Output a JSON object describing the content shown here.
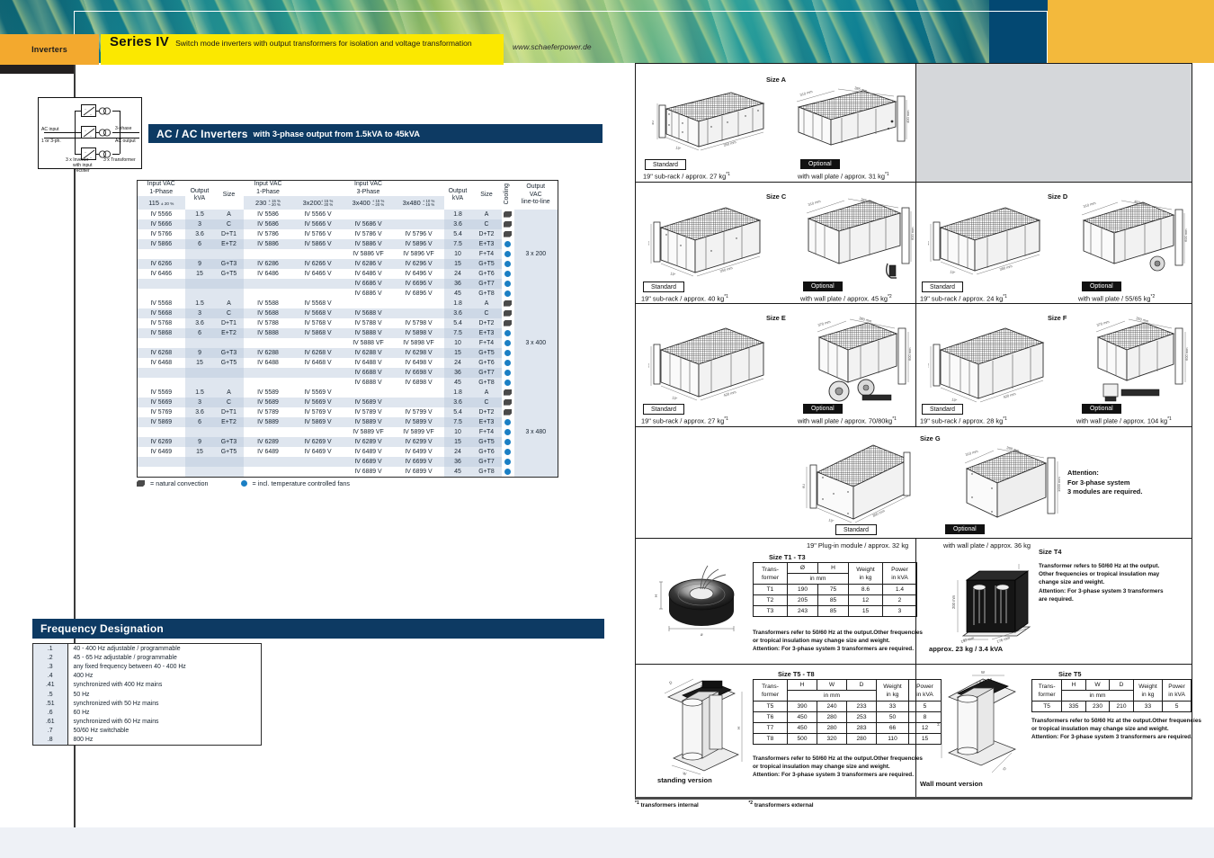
{
  "header": {
    "category": "Inverters",
    "series": "Series IV",
    "subtitle": "Switch mode inverters with output transformers for isolation and voltage transformation",
    "url": "www.schaeferpower.de",
    "accent_yellow": "#fbe800",
    "accent_orange": "#f3a92e",
    "accent_navy": "#0d3a63",
    "accent_gold": "#f3b93c"
  },
  "block_diagram": {
    "ac_input": "AC input",
    "phase_in": "1 or 3-ph.",
    "out_top": "3-phase",
    "out_bottom": "AC output",
    "left_caption_1": "3 x Inverter",
    "left_caption_2": "with input",
    "left_caption_3": "rectifier",
    "right_caption": "3 x Transformer"
  },
  "section_titles": {
    "acac": "AC / AC Inverters",
    "acac_sub": "with 3-phase output from 1.5kVA to 45kVA",
    "frequency": "Frequency Designation"
  },
  "main_table": {
    "headers": {
      "g1_title": "Input VAC\n1-Phase",
      "g1_sub": "115",
      "g1_tol": "± 20 %",
      "out_kva_1": "Output\nkVA",
      "size_1": "Size",
      "g2_title": "Input VAC\n1-Phase",
      "g2_sub": "230",
      "g2_tol_top": "+ 15 %",
      "g2_tol_bot": "– 20 %",
      "g3_title": "Input VAC\n3-Phase",
      "g3a_sub": "3x200",
      "g3a_tol_top": "+ 15 %",
      "g3a_tol_bot": "– 20 %",
      "g3b_sub": "3x400",
      "g3b_tol_top": "+ 15 %",
      "g3b_tol_bot": "– 20 %",
      "g3c_sub": "3x480",
      "g3c_tol_top": "+ 10 %",
      "g3c_tol_bot": "– 15 %",
      "out_kva_2": "Output\nkVA",
      "size_2": "Size",
      "cooling": "Cooling",
      "out_vac": "Output\nVAC\nline-to-line"
    },
    "groups": [
      {
        "output_vac": "3 x 200",
        "rows": [
          {
            "c115": "IV 5566",
            "kva1": "1.5",
            "size1": "A",
            "c230": "IV 5586",
            "c200": "IV 5566 V",
            "c400": "",
            "c480": "",
            "kva2": "1.8",
            "size2": "A",
            "cool": "conv"
          },
          {
            "c115": "IV 5666",
            "kva1": "3",
            "size1": "C",
            "c230": "IV 5686",
            "c200": "IV 5666 V",
            "c400": "IV 5686 V",
            "c480": "",
            "kva2": "3.6",
            "size2": "C",
            "cool": "conv"
          },
          {
            "c115": "IV 5766",
            "kva1": "3.6",
            "size1": "D+T1",
            "c230": "IV 5786",
            "c200": "IV 5766 V",
            "c400": "IV 5786 V",
            "c480": "IV 5796 V",
            "kva2": "5.4",
            "size2": "D+T2",
            "cool": "conv"
          },
          {
            "c115": "IV 5866",
            "kva1": "6",
            "size1": "E+T2",
            "c230": "IV 5886",
            "c200": "IV 5866 V",
            "c400": "IV 5886 V",
            "c480": "IV 5896 V",
            "kva2": "7.5",
            "size2": "E+T3",
            "cool": "fan"
          },
          {
            "c115": "",
            "kva1": "",
            "size1": "",
            "c230": "",
            "c200": "",
            "c400": "IV 5886 VF",
            "c480": "IV 5896 VF",
            "kva2": "10",
            "size2": "F+T4",
            "cool": "fan"
          },
          {
            "c115": "IV 6266",
            "kva1": "9",
            "size1": "G+T3",
            "c230": "IV 6286",
            "c200": "IV 6266 V",
            "c400": "IV 6286 V",
            "c480": "IV 6296 V",
            "kva2": "15",
            "size2": "G+T5",
            "cool": "fan"
          },
          {
            "c115": "IV 6466",
            "kva1": "15",
            "size1": "G+T5",
            "c230": "IV 6486",
            "c200": "IV 6466 V",
            "c400": "IV 6486 V",
            "c480": "IV 6496 V",
            "kva2": "24",
            "size2": "G+T6",
            "cool": "fan"
          },
          {
            "c115": "",
            "kva1": "",
            "size1": "",
            "c230": "",
            "c200": "",
            "c400": "IV 6686 V",
            "c480": "IV 6696 V",
            "kva2": "36",
            "size2": "G+T7",
            "cool": "fan"
          },
          {
            "c115": "",
            "kva1": "",
            "size1": "",
            "c230": "",
            "c200": "",
            "c400": "IV 6886 V",
            "c480": "IV 6896 V",
            "kva2": "45",
            "size2": "G+T8",
            "cool": "fan"
          }
        ]
      },
      {
        "output_vac": "3 x 400",
        "rows": [
          {
            "c115": "IV 5568",
            "kva1": "1.5",
            "size1": "A",
            "c230": "IV 5588",
            "c200": "IV 5568 V",
            "c400": "",
            "c480": "",
            "kva2": "1.8",
            "size2": "A",
            "cool": "conv"
          },
          {
            "c115": "IV 5668",
            "kva1": "3",
            "size1": "C",
            "c230": "IV 5688",
            "c200": "IV 5668 V",
            "c400": "IV 5688 V",
            "c480": "",
            "kva2": "3.6",
            "size2": "C",
            "cool": "conv"
          },
          {
            "c115": "IV 5768",
            "kva1": "3.6",
            "size1": "D+T1",
            "c230": "IV 5788",
            "c200": "IV 5768 V",
            "c400": "IV 5788 V",
            "c480": "IV 5798 V",
            "kva2": "5.4",
            "size2": "D+T2",
            "cool": "conv"
          },
          {
            "c115": "IV 5868",
            "kva1": "6",
            "size1": "E+T2",
            "c230": "IV 5888",
            "c200": "IV 5868 V",
            "c400": "IV 5888 V",
            "c480": "IV 5898 V",
            "kva2": "7.5",
            "size2": "E+T3",
            "cool": "fan"
          },
          {
            "c115": "",
            "kva1": "",
            "size1": "",
            "c230": "",
            "c200": "",
            "c400": "IV 5888 VF",
            "c480": "IV 5898 VF",
            "kva2": "10",
            "size2": "F+T4",
            "cool": "fan"
          },
          {
            "c115": "IV 6268",
            "kva1": "9",
            "size1": "G+T3",
            "c230": "IV 6288",
            "c200": "IV 6268 V",
            "c400": "IV 6288 V",
            "c480": "IV 6298 V",
            "kva2": "15",
            "size2": "G+T5",
            "cool": "fan"
          },
          {
            "c115": "IV 6468",
            "kva1": "15",
            "size1": "G+T5",
            "c230": "IV 6488",
            "c200": "IV 6468 V",
            "c400": "IV 6488 V",
            "c480": "IV 6498 V",
            "kva2": "24",
            "size2": "G+T6",
            "cool": "fan"
          },
          {
            "c115": "",
            "kva1": "",
            "size1": "",
            "c230": "",
            "c200": "",
            "c400": "IV 6688 V",
            "c480": "IV 6698 V",
            "kva2": "36",
            "size2": "G+T7",
            "cool": "fan"
          },
          {
            "c115": "",
            "kva1": "",
            "size1": "",
            "c230": "",
            "c200": "",
            "c400": "IV 6888 V",
            "c480": "IV 6898 V",
            "kva2": "45",
            "size2": "G+T8",
            "cool": "fan"
          }
        ]
      },
      {
        "output_vac": "3 x 480",
        "rows": [
          {
            "c115": "IV 5569",
            "kva1": "1.5",
            "size1": "A",
            "c230": "IV 5589",
            "c200": "IV 5569 V",
            "c400": "",
            "c480": "",
            "kva2": "1.8",
            "size2": "A",
            "cool": "conv"
          },
          {
            "c115": "IV 5669",
            "kva1": "3",
            "size1": "C",
            "c230": "IV 5689",
            "c200": "IV 5669 V",
            "c400": "IV 5689 V",
            "c480": "",
            "kva2": "3.6",
            "size2": "C",
            "cool": "conv"
          },
          {
            "c115": "IV 5769",
            "kva1": "3.6",
            "size1": "D+T1",
            "c230": "IV 5789",
            "c200": "IV 5769 V",
            "c400": "IV 5789 V",
            "c480": "IV 5799 V",
            "kva2": "5.4",
            "size2": "D+T2",
            "cool": "conv"
          },
          {
            "c115": "IV 5869",
            "kva1": "6",
            "size1": "E+T2",
            "c230": "IV 5889",
            "c200": "IV 5869 V",
            "c400": "IV 5889 V",
            "c480": "IV 5899 V",
            "kva2": "7.5",
            "size2": "E+T3",
            "cool": "fan"
          },
          {
            "c115": "",
            "kva1": "",
            "size1": "",
            "c230": "",
            "c200": "",
            "c400": "IV 5889 VF",
            "c480": "IV 5899 VF",
            "kva2": "10",
            "size2": "F+T4",
            "cool": "fan"
          },
          {
            "c115": "IV 6269",
            "kva1": "9",
            "size1": "G+T3",
            "c230": "IV 6289",
            "c200": "IV 6269 V",
            "c400": "IV 6289 V",
            "c480": "IV 6299 V",
            "kva2": "15",
            "size2": "G+T5",
            "cool": "fan"
          },
          {
            "c115": "IV 6469",
            "kva1": "15",
            "size1": "G+T5",
            "c230": "IV 6489",
            "c200": "IV 6469 V",
            "c400": "IV 6489 V",
            "c480": "IV 6499 V",
            "kva2": "24",
            "size2": "G+T6",
            "cool": "fan"
          },
          {
            "c115": "",
            "kva1": "",
            "size1": "",
            "c230": "",
            "c200": "",
            "c400": "IV 6689 V",
            "c480": "IV 6699 V",
            "kva2": "36",
            "size2": "G+T7",
            "cool": "fan"
          },
          {
            "c115": "",
            "kva1": "",
            "size1": "",
            "c230": "",
            "c200": "",
            "c400": "IV 6889 V",
            "c480": "IV 6899 V",
            "kva2": "45",
            "size2": "G+T8",
            "cool": "fan"
          }
        ]
      }
    ],
    "legend": {
      "convection": "= natural convection",
      "fans": "= incl. temperature controlled fans"
    }
  },
  "frequency_designation": {
    "rows": [
      {
        "code": ".1",
        "desc": "40 - 400 Hz adjustable / programmable"
      },
      {
        "code": ".2",
        "desc": "45 - 65 Hz adjustable / programmable"
      },
      {
        "code": ".3",
        "desc": "any fixed frequency between 40 - 400 Hz"
      },
      {
        "code": ".4",
        "desc": "400 Hz"
      },
      {
        "code": ".41",
        "desc": "synchronized with 400 Hz mains"
      },
      {
        "code": ".5",
        "desc": "50 Hz"
      },
      {
        "code": ".51",
        "desc": "synchronized with 50 Hz mains"
      },
      {
        "code": ".6",
        "desc": "60 Hz"
      },
      {
        "code": ".61",
        "desc": "synchronized with 60 Hz mains"
      },
      {
        "code": ".7",
        "desc": "50/60 Hz switchable"
      },
      {
        "code": ".8",
        "desc": "800 Hz"
      }
    ]
  },
  "enclosures": {
    "tag_standard": "Standard",
    "tag_optional": "Optional",
    "size_a": {
      "title": "Size A",
      "std_caption": "19\" sub-rack  / approx. 27 kg",
      "std_sup": "*1",
      "opt_caption": "with wall plate  / approx. 31 kg",
      "opt_sup": "*1",
      "dim_w": "310 mm",
      "dim_d": "385 mm",
      "dim_h": "400 mm",
      "dim_front": "19\"",
      "dim_depth": "350 mm",
      "dim_u": "4U"
    },
    "size_c": {
      "title": "Size C",
      "std_caption": "19\" sub-rack  / approx. 40 kg",
      "std_sup": "*1",
      "opt_caption": "with wall plate  / approx. 45 kg",
      "opt_sup": "*2",
      "dim_w": "310 mm",
      "dim_d": "385 mm",
      "dim_h": "600 mm",
      "dim_front": "19\"",
      "dim_depth": "350 mm",
      "dim_u": "6U"
    },
    "size_d": {
      "title": "Size D",
      "std_caption": "19\" sub-rack / approx. 24 kg",
      "std_sup": "*1",
      "opt_caption": "with wall plate / 55/65 kg",
      "opt_sup": "*2",
      "dim_w": "310 mm",
      "dim_d": "460 mm",
      "dim_h": "600 mm",
      "dim_front": "19\"",
      "dim_depth": "380 mm",
      "dim_u": "4U"
    },
    "size_e": {
      "title": "Size E",
      "std_caption": "19\" sub-rack / approx. 27 kg",
      "std_sup": "*1",
      "opt_caption": "with wall plate / approx. 70/80kg",
      "opt_sup": "*1",
      "dim_w": "370 mm",
      "dim_d": "380 mm",
      "dim_h": "600 mm",
      "dim_front": "19\"",
      "dim_depth": "420 mm",
      "dim_u": "6U"
    },
    "size_f": {
      "title": "Size F",
      "std_caption": "19\" sub-rack / approx. 28 kg",
      "std_sup": "*1",
      "opt_caption": "with wall plate / approx. 104 kg",
      "opt_sup": "*1",
      "dim_w": "370 mm",
      "dim_d": "350 mm",
      "dim_h": "600 mm",
      "dim_front": "19\"",
      "dim_depth": "420 mm",
      "dim_u": "7U"
    },
    "size_g": {
      "title": "Size G",
      "std_caption": "19\" Plug-in module / approx. 32 kg",
      "opt_caption": "with wall plate / approx. 36 kg",
      "dim_w": "310 mm",
      "dim_d": "398 mm",
      "dim_h": "1000 mm",
      "dim_front": "19\"",
      "dim_depth": "360 mm",
      "dim_u": "6U"
    },
    "attention": {
      "l1": "Attention:",
      "l2": "For 3-phase system",
      "l3": "3 modules are required."
    }
  },
  "transformers": {
    "t1_t3": {
      "title": "Size T1 - T3",
      "headers": {
        "c0a": "Trans-",
        "c0b": "former",
        "c1": "Ø",
        "c2": "H",
        "unit": "in mm",
        "c3a": "Weight",
        "c3b": "in kg",
        "c4a": "Power",
        "c4b": "in kVA"
      },
      "rows": [
        {
          "former": "T1",
          "d": "190",
          "h": "75",
          "weight": "8.6",
          "power": "1.4"
        },
        {
          "former": "T2",
          "d": "205",
          "h": "85",
          "weight": "12",
          "power": "2"
        },
        {
          "former": "T3",
          "d": "243",
          "h": "85",
          "weight": "15",
          "power": "3"
        }
      ],
      "note_l1": "Transformers refer to 50/60 Hz at the output.Other frequencies",
      "note_l2": "or tropical insulation may change size and weight.",
      "note_l3": "Attention: For 3-phase system 3 transformers are required."
    },
    "t4": {
      "title": "Size T4",
      "note_l1": "Transformer refers to 50/60 Hz at the output.",
      "note_l2": "Other frequencies or tropical insulation may",
      "note_l3": "change size and weight.",
      "note_l4": "Attention: For 3-phase system 3 transformers",
      "note_l5": "are required.",
      "caption": "approx. 23 kg / 3.4 kVA",
      "dim_h": "200 mm",
      "dim_w": "192 mm",
      "dim_d": "176 mm"
    },
    "t5_t8": {
      "title": "Size T5 - T8",
      "headers": {
        "c0a": "Trans-",
        "c0b": "former",
        "c1": "H",
        "c2": "W",
        "c3": "D",
        "unit": "in mm",
        "c4a": "Weight",
        "c4b": "in kg",
        "c5a": "Power",
        "c5b": "in kVA"
      },
      "rows": [
        {
          "former": "T5",
          "h": "390",
          "w": "240",
          "d": "233",
          "weight": "33",
          "power": "5"
        },
        {
          "former": "T6",
          "h": "450",
          "w": "280",
          "d": "253",
          "weight": "50",
          "power": "8"
        },
        {
          "former": "T7",
          "h": "450",
          "w": "280",
          "d": "283",
          "weight": "66",
          "power": "12"
        },
        {
          "former": "T8",
          "h": "500",
          "w": "320",
          "d": "280",
          "weight": "110",
          "power": "15"
        }
      ],
      "note_l1": "Transformers refer to 50/60 Hz at the output.Other frequencies",
      "note_l2": "or tropical insulation may change size and weight.",
      "note_l3": "Attention: For 3-phase system 3 transformers are required.",
      "caption": "standing version"
    },
    "t5_wall": {
      "title": "Size T5",
      "headers": {
        "c0a": "Trans-",
        "c0b": "former",
        "c1": "H",
        "c2": "W",
        "c3": "D",
        "unit": "in mm",
        "c4a": "Weight",
        "c4b": "in kg",
        "c5a": "Power",
        "c5b": "in kVA"
      },
      "rows": [
        {
          "former": "T5",
          "h": "335",
          "w": "230",
          "d": "210",
          "weight": "33",
          "power": "5"
        }
      ],
      "note_l1": "Transformers refer to 50/60 Hz at the output.Other frequencies",
      "note_l2": "or tropical insulation may change size and weight.",
      "note_l3": "Attention: For 3-phase system 3 transformers are required.",
      "caption": "Wall mount version"
    }
  },
  "footnotes": {
    "internal": "transformers internal",
    "internal_sup": "*1",
    "external": "transformers external",
    "external_sup": "*2"
  }
}
